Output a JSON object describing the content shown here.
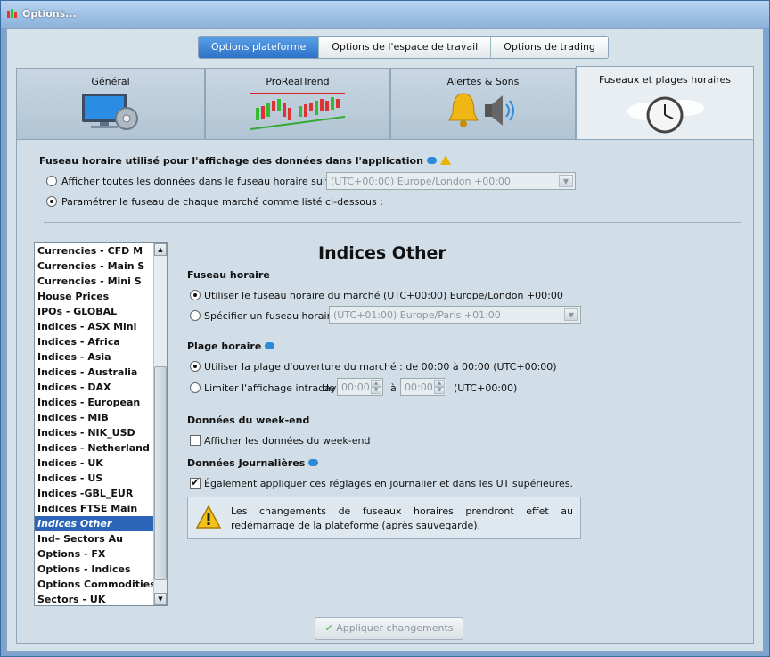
{
  "window": {
    "title": "Options..."
  },
  "top_tabs": [
    {
      "label": "Options plateforme",
      "active": true
    },
    {
      "label": "Options de l'espace de travail",
      "active": false
    },
    {
      "label": "Options de trading",
      "active": false
    }
  ],
  "icon_tabs": [
    {
      "label": "Général",
      "icon": "monitor-gear-icon"
    },
    {
      "label": "ProRealTrend",
      "icon": "candlestick-chart-icon"
    },
    {
      "label": "Alertes & Sons",
      "icon": "bell-speaker-icon"
    },
    {
      "label": "Fuseaux et plages horaires",
      "icon": "world-clock-icon",
      "active": true
    }
  ],
  "timezone_section": {
    "title": "Fuseau horaire utilisé pour l'affichage des données dans l'application",
    "opt_all": "Afficher toutes les données dans le fuseau horaire suivant :",
    "opt_all_value": "(UTC+00:00) Europe/London +00:00",
    "opt_each": "Paramétrer le fuseau de chaque marché comme listé ci-dessous :"
  },
  "markets": [
    "Currencies - CFD M",
    "Currencies - Main S",
    "Currencies - Mini S",
    "House Prices",
    "IPOs - GLOBAL",
    "Indices - ASX Mini",
    "Indices - Africa",
    "Indices - Asia",
    "Indices - Australia",
    "Indices - DAX",
    "Indices - European",
    "Indices - MIB",
    "Indices - NIK_USD",
    "Indices - Netherland",
    "Indices - UK",
    "Indices - US",
    "Indices -GBL_EUR",
    "Indices FTSE Main",
    "Indices Other",
    "Ind– Sectors Au",
    "Options - FX",
    "Options - Indices",
    "Options Commodities",
    "Sectors - UK"
  ],
  "selected_market": "Indices Other",
  "detail": {
    "heading": "Indices Other",
    "fuseau_title": "Fuseau horaire",
    "fuseau_market": "Utiliser le fuseau horaire du marché (UTC+00:00) Europe/London +00:00",
    "fuseau_custom": "Spécifier un fuseau horaire :",
    "fuseau_custom_value": "(UTC+01:00) Europe/Paris +01:00",
    "plage_title": "Plage horaire",
    "plage_open": "Utiliser la plage d'ouverture du marché : de 00:00 à 00:00  (UTC+00:00)",
    "plage_limit": "Limiter l'affichage intraday",
    "plage_de": "de",
    "plage_from": "00:00",
    "plage_a": "à",
    "plage_to": "00:00",
    "plage_tz": "(UTC+00:00)",
    "weekend_title": "Données du week-end",
    "weekend_cb": "Afficher les données du week-end",
    "daily_title": "Données Journalières",
    "daily_cb": "Également appliquer ces réglages en journalier et dans les UT supérieures.",
    "info": "Les changements de fuseaux horaires prendront effet au redémarrage de la plateforme (après sauvegarde).",
    "apply": "Appliquer changements"
  }
}
